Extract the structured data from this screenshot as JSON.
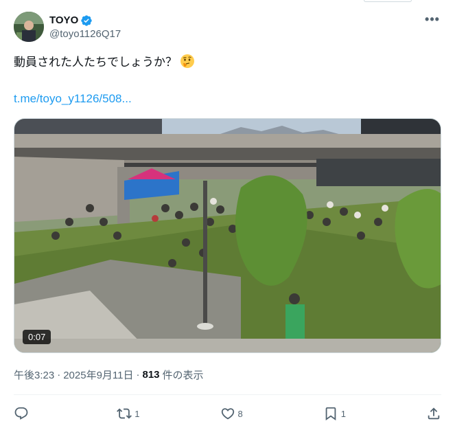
{
  "header": {
    "display_name": "TOYO",
    "handle": "@toyo1126Q17",
    "more_label": "•••"
  },
  "tweet": {
    "text": "動員された人たちでしょうか？",
    "emoji": "thinking-face",
    "link": "t.me/toyo_y1126/508..."
  },
  "media": {
    "duration": "0:07"
  },
  "meta": {
    "time": "午後3:23",
    "sep1": "·",
    "date": "2025年9月11日",
    "sep2": "·",
    "views": "813",
    "views_label": "件の表示"
  },
  "actions": {
    "reply_count": "",
    "retweet_count": "1",
    "like_count": "8",
    "bookmark_count": "1"
  },
  "colors": {
    "accent": "#1d9bf0",
    "text": "#0f1419",
    "secondary": "#536471"
  },
  "icons": [
    "verified-badge-icon",
    "more-icon",
    "thinking-face-emoji",
    "reply-icon",
    "retweet-icon",
    "like-icon",
    "bookmark-icon",
    "share-icon"
  ]
}
